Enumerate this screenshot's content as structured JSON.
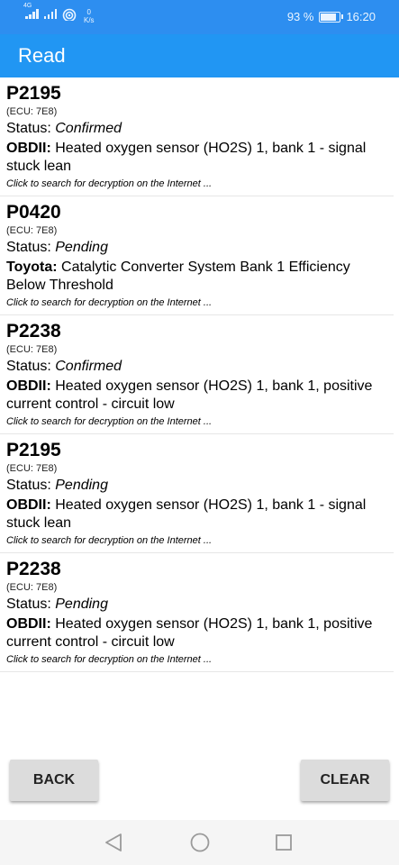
{
  "statusbar": {
    "network_tag": "4G",
    "speed_value": "0",
    "speed_unit": "K/s",
    "battery": "93 %",
    "battery_level": 0.93,
    "time": "16:20"
  },
  "appbar": {
    "title": "Read"
  },
  "codes": [
    {
      "code": "P2195",
      "ecu": "(ECU: 7E8)",
      "status_label": "Status: ",
      "status": "Confirmed",
      "source": "OBDII:",
      "description": " Heated oxygen sensor (HO2S) 1, bank 1 - signal stuck lean",
      "hint": "Click to search for decryption on the Internet ..."
    },
    {
      "code": "P0420",
      "ecu": "(ECU: 7E8)",
      "status_label": "Status: ",
      "status": "Pending",
      "source": "Toyota:",
      "description": " Catalytic Converter System Bank 1 Efficiency Below Threshold",
      "hint": "Click to search for decryption on the Internet ..."
    },
    {
      "code": "P2238",
      "ecu": "(ECU: 7E8)",
      "status_label": "Status: ",
      "status": "Confirmed",
      "source": "OBDII:",
      "description": " Heated oxygen sensor (HO2S) 1, bank 1, positive current control - circuit low",
      "hint": "Click to search for decryption on the Internet ..."
    },
    {
      "code": "P2195",
      "ecu": "(ECU: 7E8)",
      "status_label": "Status: ",
      "status": "Pending",
      "source": "OBDII:",
      "description": " Heated oxygen sensor (HO2S) 1, bank 1 - signal stuck lean",
      "hint": "Click to search for decryption on the Internet ..."
    },
    {
      "code": "P2238",
      "ecu": "(ECU: 7E8)",
      "status_label": "Status: ",
      "status": "Pending",
      "source": "OBDII:",
      "description": " Heated oxygen sensor (HO2S) 1, bank 1, positive current control - circuit low",
      "hint": "Click to search for decryption on the Internet ..."
    }
  ],
  "buttons": {
    "back": "BACK",
    "clear": "CLEAR"
  },
  "colors": {
    "statusbar": "#2d8ef0",
    "appbar": "#2196f3",
    "button": "#dcdcdc"
  },
  "icons": {
    "signal": "signal-icon",
    "wifi": "wifi-icon",
    "battery": "battery-icon",
    "nav_back": "triangle-back-icon",
    "nav_home": "circle-home-icon",
    "nav_recent": "square-recent-icon"
  }
}
